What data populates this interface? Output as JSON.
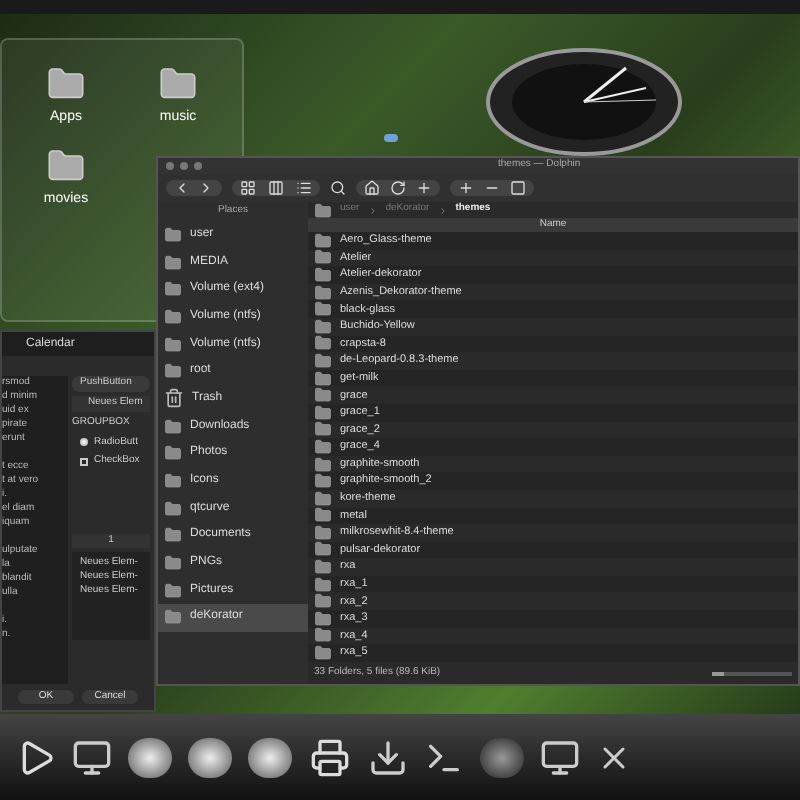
{
  "desktop_folders": [
    {
      "label": "Apps"
    },
    {
      "label": "music"
    },
    {
      "label": "movies"
    }
  ],
  "widget_window": {
    "tab": "Calendar",
    "push_button": "PushButton",
    "combo": "Neues Elem",
    "groupbox": "GROUPBOX",
    "radio": {
      "label": "RadioButt",
      "checked": true
    },
    "checkbox": {
      "label": "CheckBox",
      "checked": false
    },
    "spin": "1",
    "tree_items": [
      {
        "label": "Neues Elem-"
      },
      {
        "label": "Neues Elem-"
      },
      {
        "label": "Neues Elem-"
      }
    ],
    "paragraphs": [
      [
        "rsmod",
        "d minim",
        "uid ex",
        "pirate",
        "erunt"
      ],
      [
        "t ecce",
        "t at vero",
        "i.",
        "el diam",
        "iquam"
      ],
      [
        "ulputate",
        "la",
        "blandit",
        "ulla"
      ],
      [
        "i.",
        "n."
      ]
    ],
    "buttons": [
      "OK",
      "Cancel"
    ]
  },
  "dolphin": {
    "title": "themes — Dolphin",
    "places_title": "Places",
    "places": [
      {
        "label": "user",
        "selected": false
      },
      {
        "label": "MEDIA",
        "selected": false
      },
      {
        "label": "Volume (ext4)",
        "selected": false
      },
      {
        "label": "Volume (ntfs)",
        "selected": false
      },
      {
        "label": "Volume (ntfs)",
        "selected": false
      },
      {
        "label": "root",
        "selected": false
      },
      {
        "label": "Trash",
        "selected": false
      },
      {
        "label": "Downloads",
        "selected": false
      },
      {
        "label": "Photos",
        "selected": false
      },
      {
        "label": "Icons",
        "selected": false
      },
      {
        "label": "qtcurve",
        "selected": false
      },
      {
        "label": "Documents",
        "selected": false
      },
      {
        "label": "PNGs",
        "selected": false
      },
      {
        "label": "Pictures",
        "selected": false
      },
      {
        "label": "deKorator",
        "selected": true
      }
    ],
    "breadcrumb": [
      "user",
      "deKorator",
      "themes"
    ],
    "column": "Name",
    "files": [
      "Aero_Glass-theme",
      "Atelier",
      "Atelier-dekorator",
      "Azenis_Dekorator-theme",
      "black-glass",
      "Buchido-Yellow",
      "crapsta-8",
      "de-Leopard-0.8.3-theme",
      "get-milk",
      "grace",
      "grace_1",
      "grace_2",
      "grace_4",
      "graphite-smooth",
      "graphite-smooth_2",
      "kore-theme",
      "metal",
      "milkrosewhit-8.4-theme",
      "pulsar-dekorator",
      "rxa",
      "rxa_1",
      "rxa_2",
      "rxa_3",
      "rxa_4",
      "rxa_5"
    ],
    "status": "33 Folders, 5 files (89.6 KiB)",
    "zoom": {
      "level": 0.15
    }
  }
}
